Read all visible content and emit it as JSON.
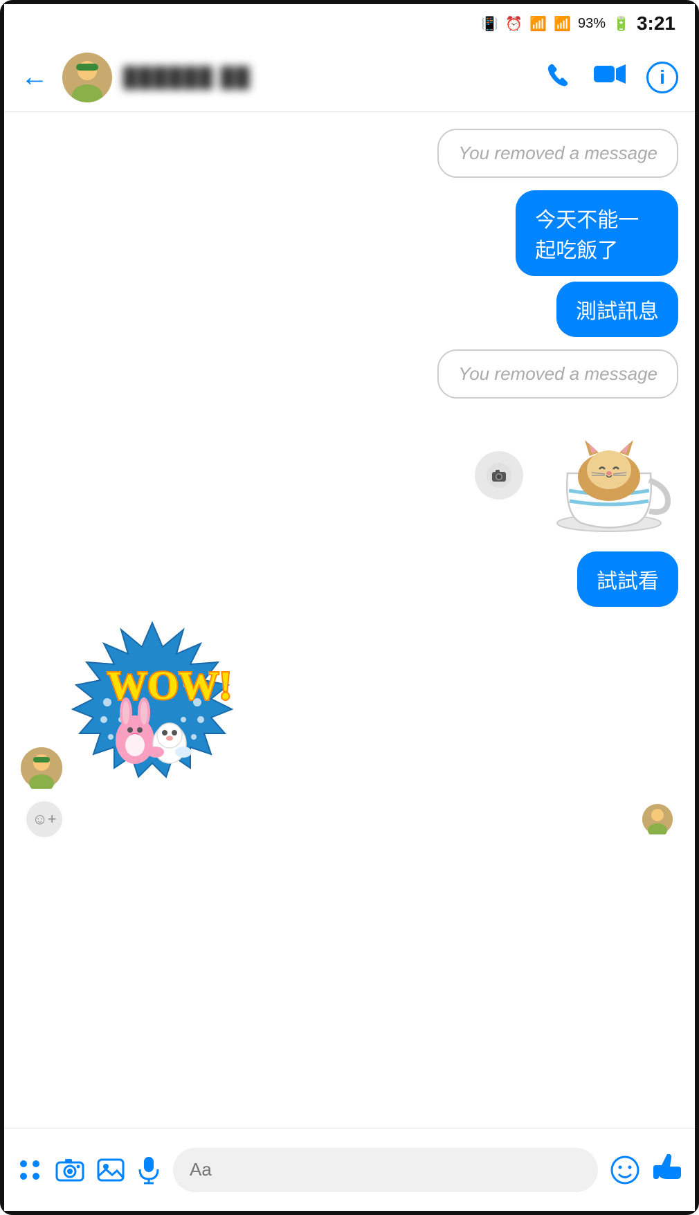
{
  "statusBar": {
    "time": "3:21",
    "battery": "93%",
    "icons": [
      "vibrate",
      "alarm",
      "wifi",
      "signal",
      "battery"
    ]
  },
  "navBar": {
    "backLabel": "←",
    "contactName": "██████ ██",
    "callIcon": "📞",
    "videoIcon": "📹",
    "infoIcon": "i"
  },
  "messages": [
    {
      "id": 1,
      "type": "removed",
      "side": "right",
      "text": "You removed a message"
    },
    {
      "id": 2,
      "type": "text",
      "side": "right",
      "text": "今天不能一起吃飯了"
    },
    {
      "id": 3,
      "type": "text",
      "side": "right",
      "text": "測試訊息"
    },
    {
      "id": 4,
      "type": "removed",
      "side": "right",
      "text": "You removed a message"
    },
    {
      "id": 5,
      "type": "sticker-cat",
      "side": "right"
    },
    {
      "id": 6,
      "type": "text",
      "side": "right",
      "text": "試試看"
    },
    {
      "id": 7,
      "type": "sticker-wow",
      "side": "left"
    }
  ],
  "inputBar": {
    "placeholder": "Aa",
    "icons": [
      "menu",
      "camera",
      "image",
      "mic"
    ],
    "thumbLabel": "👍"
  }
}
